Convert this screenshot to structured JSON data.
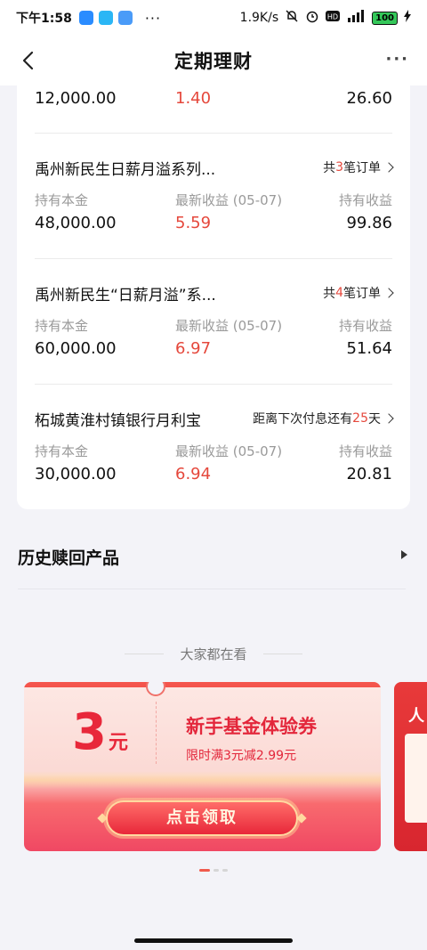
{
  "status_bar": {
    "time": "下午1:58",
    "speed": "1.9K/s",
    "battery": "100",
    "app_icons": [
      "blue-app-icon",
      "cyan-app-icon",
      "pay-app-icon"
    ],
    "more": "···"
  },
  "header": {
    "title": "定期理财",
    "back_icon": "chevron-left-icon",
    "more": "···"
  },
  "labels": {
    "principal": "持有本金",
    "latest_income_prefix": "最新收益 ",
    "held_income": "持有收益"
  },
  "partial_row": {
    "principal": "12,000.00",
    "latest": "1.40",
    "held": "26.60"
  },
  "products": [
    {
      "name": "禹州新民生日薪月溢系列...",
      "link_prefix": "共",
      "link_num": "3",
      "link_suffix": "笔订单",
      "latest_label": "最新收益 (05-07)",
      "principal": "48,000.00",
      "latest": "5.59",
      "held": "99.86"
    },
    {
      "name": "禹州新民生“日薪月溢”系...",
      "link_prefix": "共",
      "link_num": "4",
      "link_suffix": "笔订单",
      "latest_label": "最新收益 (05-07)",
      "principal": "60,000.00",
      "latest": "6.97",
      "held": "51.64"
    },
    {
      "name": "柘城黄淮村镇银行月利宝",
      "link_prefix": "距离下次付息还有",
      "link_num": "25",
      "link_suffix": "天",
      "latest_label": "最新收益 (05-07)",
      "principal": "30,000.00",
      "latest": "6.94",
      "held": "20.81"
    }
  ],
  "history": {
    "title": "历史赎回产品"
  },
  "everyone_watching": "大家都在看",
  "banner": {
    "amount": "3",
    "unit": "元",
    "title": "新手基金体验券",
    "subtitle": "限时满3元减2.99元",
    "button": "点击领取"
  },
  "banner2": {
    "title_char": "人"
  },
  "colors": {
    "accent_red": "#e5483c",
    "banner_red": "#e3273b"
  }
}
